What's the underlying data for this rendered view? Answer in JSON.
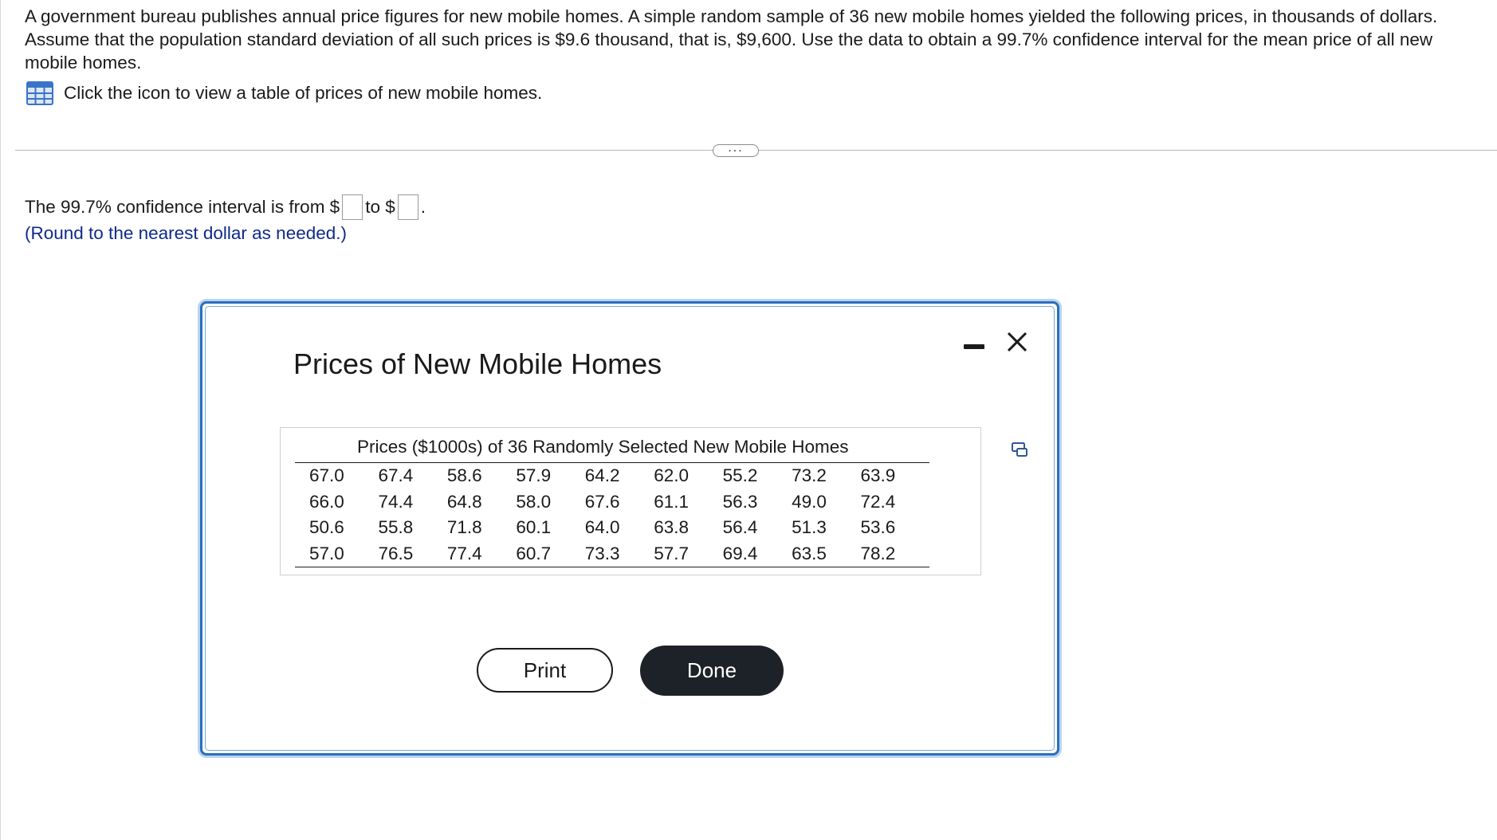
{
  "question": {
    "text": "A government bureau publishes annual price figures for new mobile homes. A simple random sample of 36 new mobile homes yielded the following prices, in thousands of dollars. Assume that the population standard deviation of all such prices is $9.6 thousand, that is, $9,600. Use the data to obtain a 99.7% confidence interval for the mean price of all new mobile homes.",
    "icon_link_text": "Click the icon to view a table of prices of new mobile homes."
  },
  "more_button": "...",
  "answer": {
    "prefix": "The 99.7% confidence interval is from $",
    "middle": "to $",
    "suffix": ".",
    "lower_value": "",
    "upper_value": "",
    "hint": "(Round to the nearest dollar as needed.)"
  },
  "modal": {
    "title": "Prices of New Mobile Homes",
    "table_caption": "Prices ($1000s) of 36 Randomly Selected New Mobile Homes",
    "rows": [
      [
        "67.0",
        "67.4",
        "58.6",
        "57.9",
        "64.2",
        "62.0",
        "55.2",
        "73.2",
        "63.9"
      ],
      [
        "66.0",
        "74.4",
        "64.8",
        "58.0",
        "67.6",
        "61.1",
        "56.3",
        "49.0",
        "72.4"
      ],
      [
        "50.6",
        "55.8",
        "71.8",
        "60.1",
        "64.0",
        "63.8",
        "56.4",
        "51.3",
        "53.6"
      ],
      [
        "57.0",
        "76.5",
        "77.4",
        "60.7",
        "73.3",
        "57.7",
        "69.4",
        "63.5",
        "78.2"
      ]
    ],
    "print_label": "Print",
    "done_label": "Done"
  },
  "colors": {
    "hint_text": "#0f2a8a",
    "modal_border": "#2a6fbd",
    "done_button": "#1d2228",
    "table_icon": "#3b73c9"
  },
  "icons": {
    "table_icon": "table-grid-icon",
    "minimize": "minimize-icon",
    "close": "close-icon",
    "copy": "copy-icon"
  }
}
